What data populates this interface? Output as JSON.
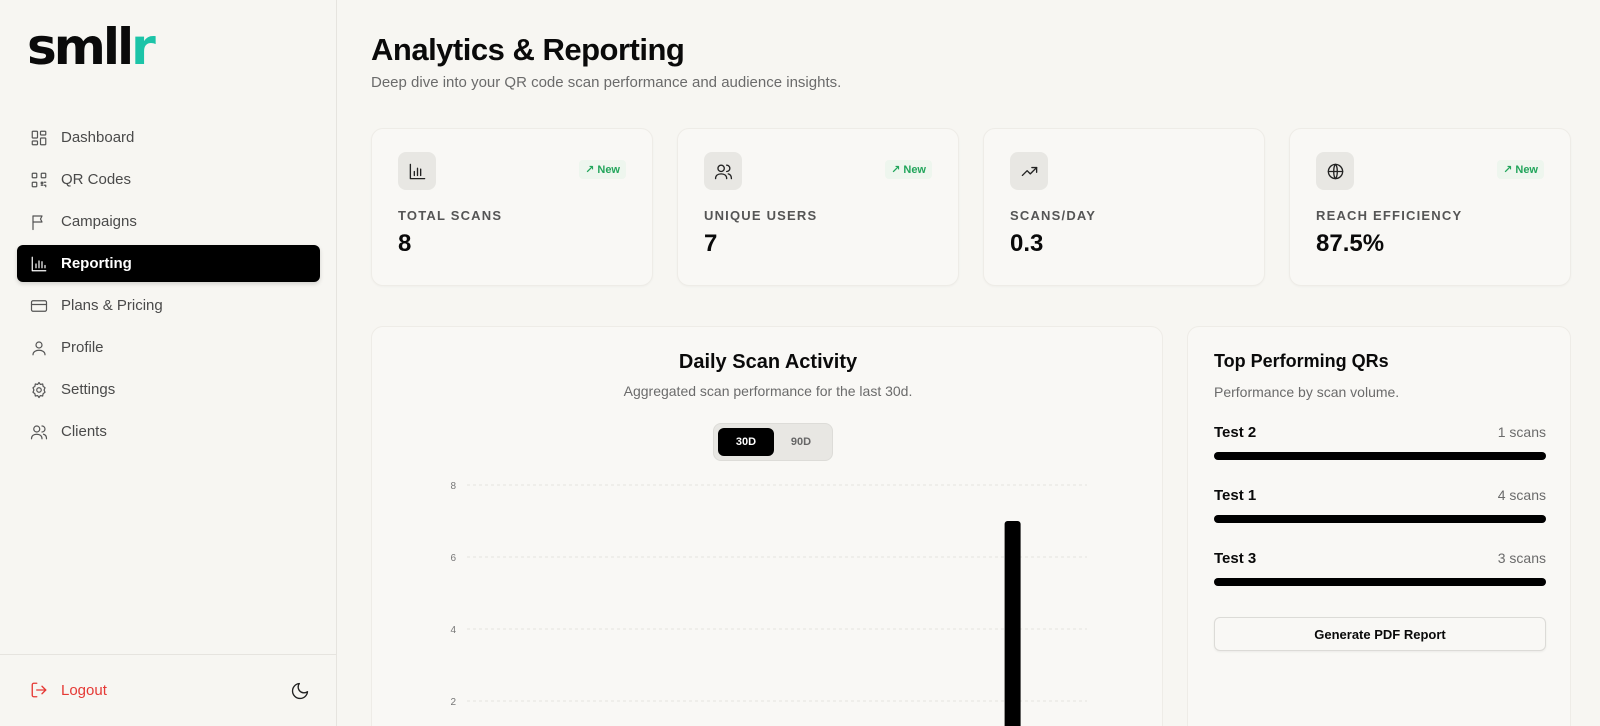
{
  "brand": {
    "part1": "sm",
    "part2": "ll",
    "part3": "r",
    "accent": "#1cc4a8"
  },
  "sidebar": {
    "items": [
      {
        "label": "Dashboard",
        "icon": "dashboard-icon"
      },
      {
        "label": "QR Codes",
        "icon": "qr-code-icon"
      },
      {
        "label": "Campaigns",
        "icon": "flag-icon"
      },
      {
        "label": "Reporting",
        "icon": "bar-chart-icon",
        "active": true
      },
      {
        "label": "Plans & Pricing",
        "icon": "credit-card-icon"
      },
      {
        "label": "Profile",
        "icon": "user-icon"
      },
      {
        "label": "Settings",
        "icon": "gear-icon"
      },
      {
        "label": "Clients",
        "icon": "users-icon"
      }
    ],
    "logout_label": "Logout"
  },
  "header": {
    "title": "Analytics & Reporting",
    "subtitle": "Deep dive into your QR code scan performance and audience insights."
  },
  "stats": [
    {
      "label": "TOTAL SCANS",
      "value": "8",
      "badge": "New",
      "icon": "bar-chart-icon"
    },
    {
      "label": "UNIQUE USERS",
      "value": "7",
      "badge": "New",
      "icon": "users-icon"
    },
    {
      "label": "SCANS/DAY",
      "value": "0.3",
      "badge": "",
      "icon": "trending-up-icon"
    },
    {
      "label": "REACH EFFICIENCY",
      "value": "87.5%",
      "badge": "New",
      "icon": "globe-icon"
    }
  ],
  "daily_chart": {
    "title": "Daily Scan Activity",
    "subtitle": "Aggregated scan performance for the last 30d.",
    "range_options": [
      "30D",
      "90D"
    ],
    "selected_range": "30D"
  },
  "chart_data": {
    "type": "bar",
    "title": "Daily Scan Activity",
    "yticks": [
      "2",
      "4",
      "6",
      "8"
    ],
    "ylim": [
      0,
      8
    ],
    "grid": true,
    "bars": [
      {
        "position": 0.88,
        "value": 7
      }
    ]
  },
  "top_qrs": {
    "title": "Top Performing QRs",
    "subtitle": "Performance by scan volume.",
    "items": [
      {
        "name": "Test 2",
        "count": "1 scans",
        "fill": 1.0
      },
      {
        "name": "Test 1",
        "count": "4 scans",
        "fill": 1.0
      },
      {
        "name": "Test 3",
        "count": "3 scans",
        "fill": 1.0
      }
    ],
    "button_label": "Generate PDF Report"
  }
}
